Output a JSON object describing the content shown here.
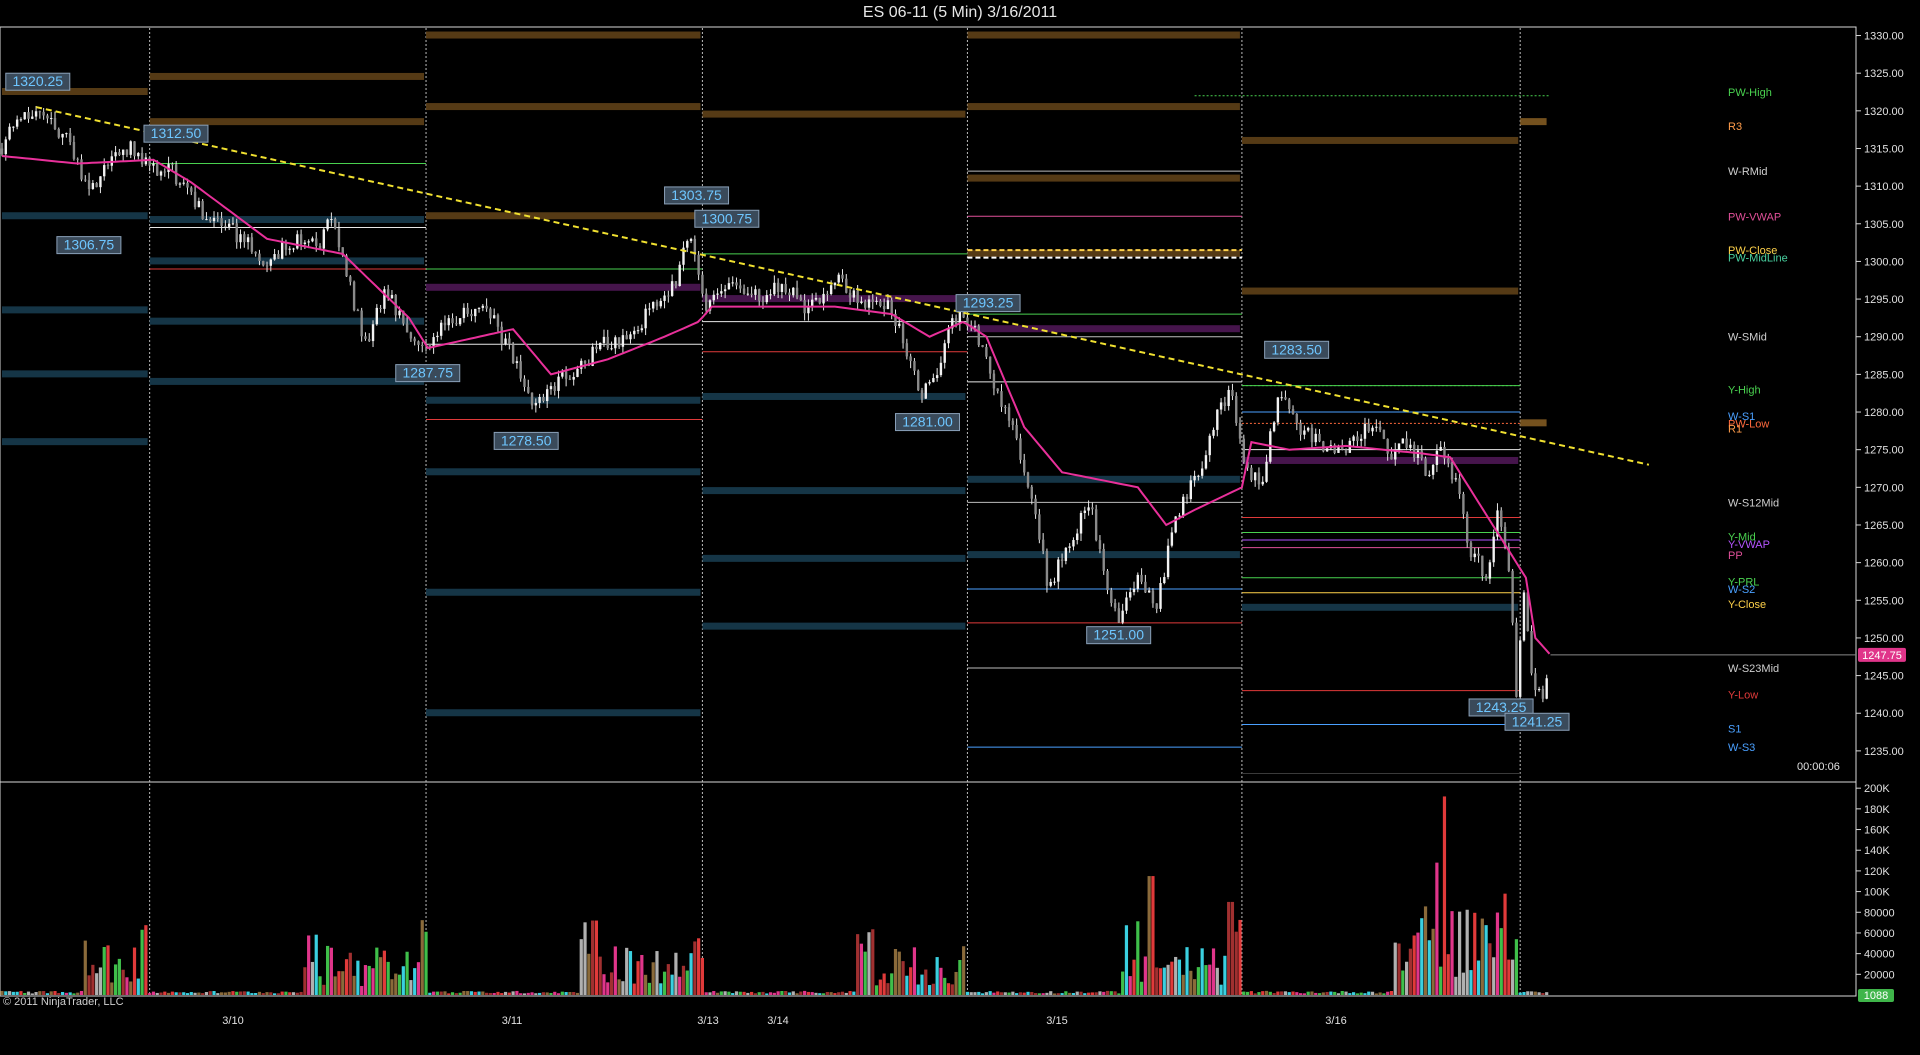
{
  "window": {
    "title": "ES 06-11 (5 Min)  3/16/2011"
  },
  "footer": {
    "credit": "© 2011 NinjaTrader, LLC",
    "timer": "00:00:06"
  },
  "chart_data": {
    "type": "line",
    "instrument": "ES 06-11",
    "interval": "5 Min",
    "price_axis": {
      "ticks": [
        1235,
        1240,
        1245,
        1250,
        1255,
        1260,
        1265,
        1270,
        1275,
        1280,
        1285,
        1290,
        1295,
        1300,
        1305,
        1310,
        1315,
        1320,
        1325,
        1330
      ],
      "tick_labels": [
        "1235.00",
        "1240.00",
        "1245.00",
        "1250.00",
        "1255.00",
        "1260.00",
        "1265.00",
        "1270.00",
        "1275.00",
        "1280.00",
        "1285.00",
        "1290.00",
        "1295.00",
        "1300.00",
        "1305.00",
        "1310.00",
        "1315.00",
        "1320.00",
        "1325.00",
        "1330.00"
      ],
      "range": [
        1231,
        1331
      ],
      "current_price": "1247.75",
      "current_color": "#e0358a"
    },
    "volume_axis": {
      "ticks": [
        20000,
        40000,
        60000,
        80000,
        100000,
        120000,
        140000,
        160000,
        180000,
        200000
      ],
      "tick_labels": [
        "20000",
        "40000",
        "60000",
        "80000",
        "100K",
        "120K",
        "140K",
        "160K",
        "180K",
        "200K"
      ],
      "range": [
        0,
        205000
      ],
      "current_volume": "1088"
    },
    "date_labels": [
      "3/10",
      "3/11",
      "3/13",
      "3/14",
      "3/15",
      "3/16"
    ],
    "price_anchors": [
      [
        0.0,
        1315
      ],
      [
        0.8,
        1319
      ],
      [
        2.0,
        1320.25
      ],
      [
        3.5,
        1316
      ],
      [
        4.6,
        1309
      ],
      [
        5.6,
        1313.5
      ],
      [
        6.8,
        1315
      ],
      [
        8.0,
        1312.5
      ],
      [
        9.0,
        1312
      ],
      [
        10.5,
        1306.75
      ],
      [
        12.2,
        1304
      ],
      [
        14.0,
        1300
      ],
      [
        15.5,
        1303
      ],
      [
        16.8,
        1302
      ],
      [
        17.4,
        1306
      ],
      [
        18.2,
        1298
      ],
      [
        19.2,
        1289
      ],
      [
        20.3,
        1296
      ],
      [
        21.2,
        1292
      ],
      [
        22.4,
        1288.5
      ],
      [
        23.5,
        1292
      ],
      [
        25.0,
        1294
      ],
      [
        26.0,
        1292
      ],
      [
        27.0,
        1287
      ],
      [
        28.0,
        1281
      ],
      [
        29.3,
        1284
      ],
      [
        30.5,
        1286
      ],
      [
        31.8,
        1289
      ],
      [
        33.0,
        1290
      ],
      [
        34.5,
        1294
      ],
      [
        35.5,
        1297
      ],
      [
        36.4,
        1303.75
      ],
      [
        37.2,
        1294
      ],
      [
        38.5,
        1297
      ],
      [
        40.0,
        1295
      ],
      [
        41.5,
        1297
      ],
      [
        42.5,
        1293
      ],
      [
        44.0,
        1298
      ],
      [
        45.5,
        1294
      ],
      [
        46.5,
        1295
      ],
      [
        47.5,
        1291
      ],
      [
        48.5,
        1282
      ],
      [
        49.3,
        1285
      ],
      [
        50.0,
        1291
      ],
      [
        50.7,
        1293.25
      ],
      [
        51.5,
        1290
      ],
      [
        52.5,
        1283
      ],
      [
        53.5,
        1277
      ],
      [
        54.5,
        1268
      ],
      [
        55.3,
        1256
      ],
      [
        56.2,
        1262
      ],
      [
        57.5,
        1268
      ],
      [
        58.3,
        1257
      ],
      [
        59.0,
        1252
      ],
      [
        60.0,
        1259
      ],
      [
        61.0,
        1254
      ],
      [
        62.0,
        1266
      ],
      [
        63.2,
        1272
      ],
      [
        64.2,
        1280
      ],
      [
        65.0,
        1283
      ],
      [
        65.5,
        1274
      ],
      [
        66.5,
        1270
      ],
      [
        67.5,
        1283.5
      ],
      [
        68.5,
        1278
      ],
      [
        70.0,
        1275
      ],
      [
        71.5,
        1276
      ],
      [
        72.5,
        1279
      ],
      [
        73.3,
        1274
      ],
      [
        74.2,
        1276
      ],
      [
        75.3,
        1272
      ],
      [
        76.0,
        1275
      ],
      [
        76.8,
        1271
      ],
      [
        77.5,
        1262
      ],
      [
        78.5,
        1258
      ],
      [
        79.0,
        1266
      ],
      [
        79.6,
        1260
      ],
      [
        80.0,
        1243.25
      ],
      [
        80.4,
        1255
      ],
      [
        80.8,
        1246
      ],
      [
        81.3,
        1241.25
      ],
      [
        81.8,
        1247.75
      ]
    ],
    "vwap_anchors": [
      [
        0.0,
        1314
      ],
      [
        4.0,
        1313
      ],
      [
        8.0,
        1313.5
      ],
      [
        10.0,
        1310.5
      ],
      [
        14.0,
        1303
      ],
      [
        18.0,
        1301
      ],
      [
        21.5,
        1292.5
      ],
      [
        22.5,
        1288.5
      ],
      [
        27.0,
        1291
      ],
      [
        29.0,
        1285
      ],
      [
        32.0,
        1287
      ],
      [
        35.0,
        1290
      ],
      [
        36.8,
        1292
      ],
      [
        37.5,
        1294
      ],
      [
        44.0,
        1294
      ],
      [
        47.0,
        1293
      ],
      [
        49.0,
        1290
      ],
      [
        50.8,
        1292
      ],
      [
        52.0,
        1290
      ],
      [
        54.0,
        1278
      ],
      [
        56.0,
        1272
      ],
      [
        60.0,
        1270
      ],
      [
        61.5,
        1265
      ],
      [
        63.0,
        1267
      ],
      [
        65.5,
        1270
      ],
      [
        66.0,
        1276
      ],
      [
        68.0,
        1275
      ],
      [
        71.0,
        1275.5
      ],
      [
        73.0,
        1275
      ],
      [
        75.0,
        1274.5
      ],
      [
        76.5,
        1274
      ],
      [
        78.0,
        1268
      ],
      [
        79.5,
        1262
      ],
      [
        80.5,
        1258
      ],
      [
        81.0,
        1250
      ],
      [
        81.8,
        1247.75
      ]
    ],
    "trendline": [
      [
        1.8,
        1320.5
      ],
      [
        87.0,
        1273
      ]
    ],
    "sessions": [
      {
        "start": 7.8,
        "end": 22.4,
        "high": 1313,
        "low": 1299,
        "close": 1304.5
      },
      {
        "start": 22.4,
        "end": 37.0,
        "high": 1299,
        "low": 1279,
        "close": 1289
      },
      {
        "start": 37.0,
        "end": 51.0,
        "high": 1301,
        "low": 1288,
        "close": 1292
      },
      {
        "start": 51.0,
        "end": 65.5,
        "high": 1293,
        "low": 1252,
        "close": 1284
      },
      {
        "start": 65.5,
        "end": 80.2,
        "high": 1283.5,
        "low": 1266,
        "close": 1275
      }
    ],
    "level_segments": [
      [
        51.0,
        65.5,
        1301.5,
        "#ffd24a",
        "dash"
      ],
      [
        51.0,
        65.5,
        1300.5,
        "#ffffff",
        "dash"
      ],
      [
        51.0,
        65.5,
        1312.0,
        "#bdbdbd",
        "solid"
      ],
      [
        51.0,
        65.5,
        1306.0,
        "#e05099",
        "solid"
      ],
      [
        51.0,
        65.5,
        1290.0,
        "#bdbdbd",
        "solid"
      ],
      [
        51.0,
        65.5,
        1268.0,
        "#bdbdbd",
        "solid"
      ],
      [
        51.0,
        65.5,
        1256.5,
        "#4aa0ff",
        "solid"
      ],
      [
        51.0,
        65.5,
        1246.0,
        "#bdbdbd",
        "solid"
      ],
      [
        51.0,
        65.5,
        1235.5,
        "#4aa0ff",
        "solid"
      ],
      [
        65.5,
        80.2,
        1283.5,
        "#49d14f",
        "dot"
      ],
      [
        65.5,
        80.2,
        1280.0,
        "#4aa0ff",
        "solid"
      ],
      [
        65.5,
        80.2,
        1278.5,
        "#ff6a3d",
        "dot"
      ],
      [
        65.5,
        80.2,
        1264.0,
        "#49d14f",
        "solid"
      ],
      [
        65.5,
        80.2,
        1263.0,
        "#b455ff",
        "solid"
      ],
      [
        65.5,
        80.2,
        1262.0,
        "#e05099",
        "solid"
      ],
      [
        65.5,
        80.2,
        1258.0,
        "#49d14f",
        "solid"
      ],
      [
        65.5,
        80.2,
        1256.0,
        "#ffd24a",
        "solid"
      ],
      [
        65.5,
        80.2,
        1243.0,
        "#e03a3a",
        "solid"
      ],
      [
        65.5,
        80.2,
        1238.5,
        "#4aa0ff",
        "solid"
      ],
      [
        65.5,
        80.2,
        1232.0,
        "#3a3a3a",
        "solid"
      ],
      [
        63.0,
        81.7,
        1322.0,
        "#49d14f",
        "dot"
      ]
    ],
    "level_labels": [
      {
        "text": "PW-High",
        "price": 1322.5,
        "color": "#49d14f"
      },
      {
        "text": "R3",
        "price": 1318.0,
        "color": "#ff9c4a"
      },
      {
        "text": "W-RMid",
        "price": 1312.0,
        "color": "#cfcfcf"
      },
      {
        "text": "PW-VWAP",
        "price": 1306.0,
        "color": "#e05099"
      },
      {
        "text": "PW-Close",
        "price": 1301.5,
        "color": "#ffd24a"
      },
      {
        "text": "PW-MidLine",
        "price": 1300.5,
        "color": "#49d1a0"
      },
      {
        "text": "W-SMid",
        "price": 1290.0,
        "color": "#cfcfcf"
      },
      {
        "text": "Y-High",
        "price": 1283.0,
        "color": "#49d14f"
      },
      {
        "text": "W-S1",
        "price": 1279.5,
        "color": "#4aa0ff"
      },
      {
        "text": "PW-Low",
        "price": 1278.5,
        "color": "#ff6a3d"
      },
      {
        "text": "R1",
        "price": 1277.8,
        "color": "#ff9c4a"
      },
      {
        "text": "W-S12Mid",
        "price": 1268.0,
        "color": "#cfcfcf"
      },
      {
        "text": "Y-Mid",
        "price": 1263.5,
        "color": "#49d14f"
      },
      {
        "text": "Y-VWAP",
        "price": 1262.5,
        "color": "#b455ff"
      },
      {
        "text": "PP",
        "price": 1261.0,
        "color": "#e05099"
      },
      {
        "text": "Y-PRL",
        "price": 1257.5,
        "color": "#49d14f"
      },
      {
        "text": "W-S2",
        "price": 1256.5,
        "color": "#4aa0ff"
      },
      {
        "text": "Y-Close",
        "price": 1254.5,
        "color": "#ffd24a"
      },
      {
        "text": "W-S23Mid",
        "price": 1246.0,
        "color": "#cfcfcf"
      },
      {
        "text": "Y-Low",
        "price": 1242.5,
        "color": "#e03a3a"
      },
      {
        "text": "S1",
        "price": 1238.0,
        "color": "#4aa0ff"
      },
      {
        "text": "W-S3",
        "price": 1235.5,
        "color": "#4aa0ff"
      }
    ],
    "annotations": [
      {
        "text": "1320.25",
        "x": 0.2,
        "price": 1323.8
      },
      {
        "text": "1312.50",
        "x": 7.5,
        "price": 1316.9
      },
      {
        "text": "1306.75",
        "x": 2.9,
        "price": 1302.1
      },
      {
        "text": "1303.75",
        "x": 35.0,
        "price": 1308.7
      },
      {
        "text": "1300.75",
        "x": 36.6,
        "price": 1305.6
      },
      {
        "text": "1293.25",
        "x": 50.4,
        "price": 1294.4
      },
      {
        "text": "1287.75",
        "x": 20.8,
        "price": 1285.1
      },
      {
        "text": "1283.50",
        "x": 66.7,
        "price": 1288.2
      },
      {
        "text": "1281.00",
        "x": 47.2,
        "price": 1278.6
      },
      {
        "text": "1278.50",
        "x": 26.0,
        "price": 1276.1
      },
      {
        "text": "1251.00",
        "x": 57.3,
        "price": 1250.3
      },
      {
        "text": "1243.25",
        "x": 77.5,
        "price": 1240.7
      },
      {
        "text": "1241.25",
        "x": 79.4,
        "price": 1238.8
      }
    ]
  }
}
